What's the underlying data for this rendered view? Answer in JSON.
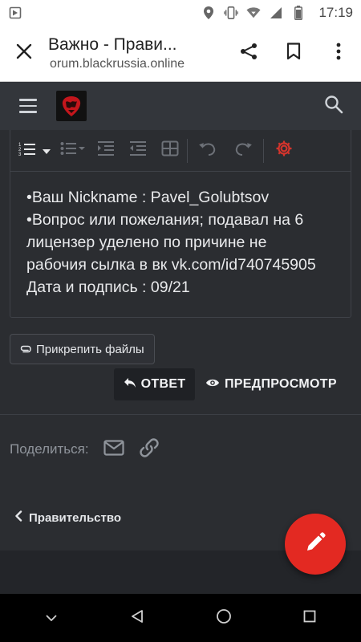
{
  "status_bar": {
    "time": "17:19",
    "icons": [
      "screenshot-icon",
      "location-icon",
      "vibrate-icon",
      "wifi-icon",
      "signal-icon",
      "battery-icon"
    ]
  },
  "browser_tab": {
    "title": "Важно - Прави...",
    "url": "orum.blackrussia.online",
    "close_icon": "close-icon",
    "lock_icon": "lock-icon",
    "actions": [
      "share-icon",
      "bookmark-icon",
      "more-vert-icon"
    ]
  },
  "site_header": {
    "menu_icon": "hamburger-icon",
    "logo": "blackrussia-logo",
    "search_icon": "search-icon"
  },
  "editor": {
    "toolbar": [
      "ordered-list-icon",
      "dropdown-caret-icon",
      "unordered-list-icon",
      "indent-icon",
      "outdent-icon",
      "table-icon",
      "undo-icon",
      "redo-icon",
      "settings-gear-icon"
    ],
    "lines": [
      "•Ваш Nickname : Pavel_Golubtsov",
      "•Вопрос или пожелания; подавал на 6",
      "лицензер уделено по причине  не",
      "рабочия сылка в вк vk.com/id740745905",
      "Дата и подпись : 09/21"
    ]
  },
  "attach_button": {
    "label": "Прикрепить файлы"
  },
  "reply_button": {
    "label": "ОТВЕТ"
  },
  "preview_button": {
    "label": "ПРЕДПРОСМОТР"
  },
  "share": {
    "label": "Поделиться:",
    "icons": [
      "email-icon",
      "link-icon"
    ]
  },
  "breadcrumb": {
    "label": "Правительство"
  },
  "fab": {
    "icon": "pencil-icon"
  },
  "nav_bar": {
    "buttons": [
      "nav-collapse-icon",
      "nav-back-icon",
      "nav-home-icon",
      "nav-recents-icon"
    ]
  },
  "colors": {
    "background": "#2b2d31",
    "header": "#33363b",
    "fab": "#e32922",
    "text": "#e9eaec",
    "muted": "#8f949b"
  }
}
